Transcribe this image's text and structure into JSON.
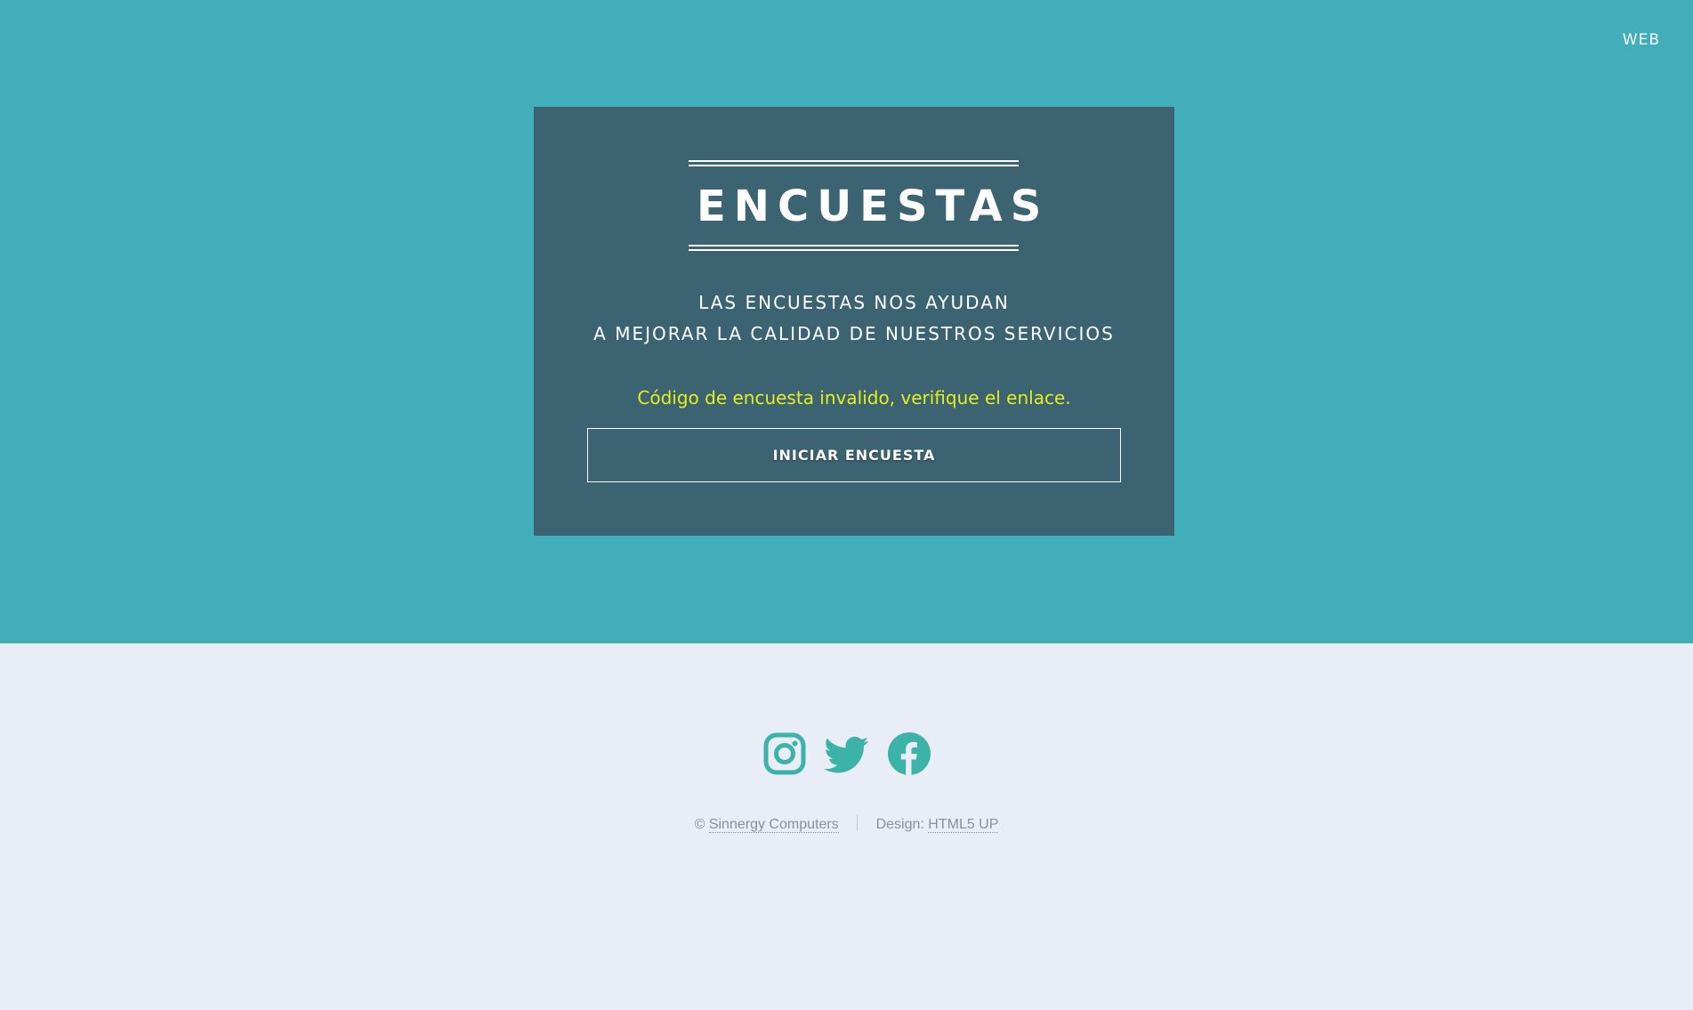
{
  "nav": {
    "web_label": "WEB"
  },
  "card": {
    "title": "ENCUESTAS",
    "subtitle_line1": "LAS ENCUESTAS NOS AYUDAN",
    "subtitle_line2": "A MEJORAR LA CALIDAD DE NUESTROS SERVICIOS",
    "error_message": "Código de encuesta invalido, verifique el enlace.",
    "start_button_label": "INICIAR ENCUESTA"
  },
  "social": {
    "icons": [
      "instagram-icon",
      "twitter-icon",
      "facebook-icon"
    ],
    "color": "#3bb3a8"
  },
  "footer": {
    "copyright_symbol": "©",
    "company_link": "Sinnergy Computers",
    "design_label": "Design:",
    "design_link": "HTML5 UP"
  },
  "colors": {
    "hero_background": "#42aeba",
    "card_background": "#3b6372",
    "error_text": "#e6ee1c",
    "page_background": "#e9edf5"
  }
}
